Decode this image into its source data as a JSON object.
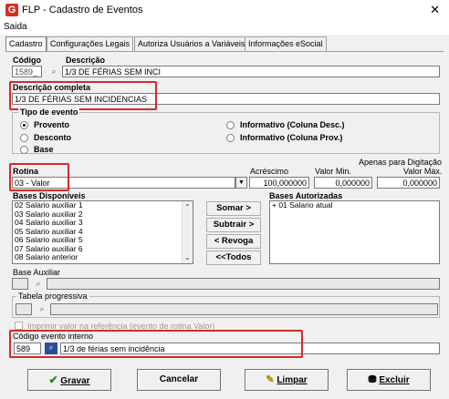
{
  "window": {
    "title": "FLP - Cadastro de Eventos",
    "close_glyph": "✕",
    "app_icon_glyph": "G",
    "app_icon_color": "#d62d20"
  },
  "menu": {
    "saida": "Saida"
  },
  "tabs": [
    {
      "label": "Cadastro",
      "active": true
    },
    {
      "label": "Configurações Legais",
      "active": false
    },
    {
      "label": "Autoriza Usuários a Variáveis",
      "active": false
    },
    {
      "label": "Informações eSocial",
      "active": false
    }
  ],
  "codigo": {
    "label": "Código",
    "value": "1589_"
  },
  "descricao": {
    "label": "Descrição",
    "value": "1/3 DE FÉRIAS SEM INCI"
  },
  "descricao_completa": {
    "label": "Descrição completa",
    "value": "1/3 DE FÉRIAS SEM INCIDENCIAS"
  },
  "tipo_evento": {
    "label": "Tipo de evento",
    "options": [
      {
        "label": "Provento",
        "selected": true
      },
      {
        "label": "Desconto",
        "selected": false
      },
      {
        "label": "Base",
        "selected": false
      },
      {
        "label": "Informativo (Coluna Desc.)",
        "selected": false
      },
      {
        "label": "Informativo (Coluna Prov.)",
        "selected": false
      }
    ]
  },
  "rotina": {
    "label": "Rotina",
    "value": "03 - Valor"
  },
  "apenas_digitacao": "Apenas para Digitação",
  "acrescimo": {
    "label": "Acréscimo",
    "value": "100,000000"
  },
  "valor_min": {
    "label": "Valor Min.",
    "value": "0,000000"
  },
  "valor_max": {
    "label": "Valor Máx.",
    "value": "0,000000"
  },
  "bases_disponiveis": {
    "label": "Bases Disponíveis",
    "items": [
      "02 Salario auxiliar 1",
      "03 Salario auxiliar 2",
      "04 Salario auxiliar 3",
      "05 Salario auxiliar 4",
      "06 Salario auxiliar 5",
      "07 Salario auxiliar 6",
      "08 Salario anterior"
    ]
  },
  "bases_autorizadas": {
    "label": "Bases Autorizadas",
    "items": [
      "+ 01 Salario atual"
    ]
  },
  "transfer_buttons": {
    "somar": "Somar >",
    "subtrair": "Subtrair >",
    "revoga": "< Revoga",
    "todos": "<<Todos"
  },
  "base_auxiliar": {
    "label": "Base Auxiliar"
  },
  "tabela_progressiva": {
    "label": "Tabela progressiva"
  },
  "imprimir_valor": {
    "label": "Imprimir valor na referência (evento de rotina Valor)"
  },
  "codigo_evento_interno": {
    "label": "Código evento interno",
    "code": "589",
    "description": "1/3 de férias sem incidência"
  },
  "actions": {
    "gravar": "Gravar",
    "cancelar": "Cancelar",
    "limpar": "Limpar",
    "excluir": "Excluir"
  },
  "colors": {
    "highlight_border": "#d42a2a",
    "window_bg": "#f0f0f0",
    "check_green": "#1c8a1c"
  }
}
